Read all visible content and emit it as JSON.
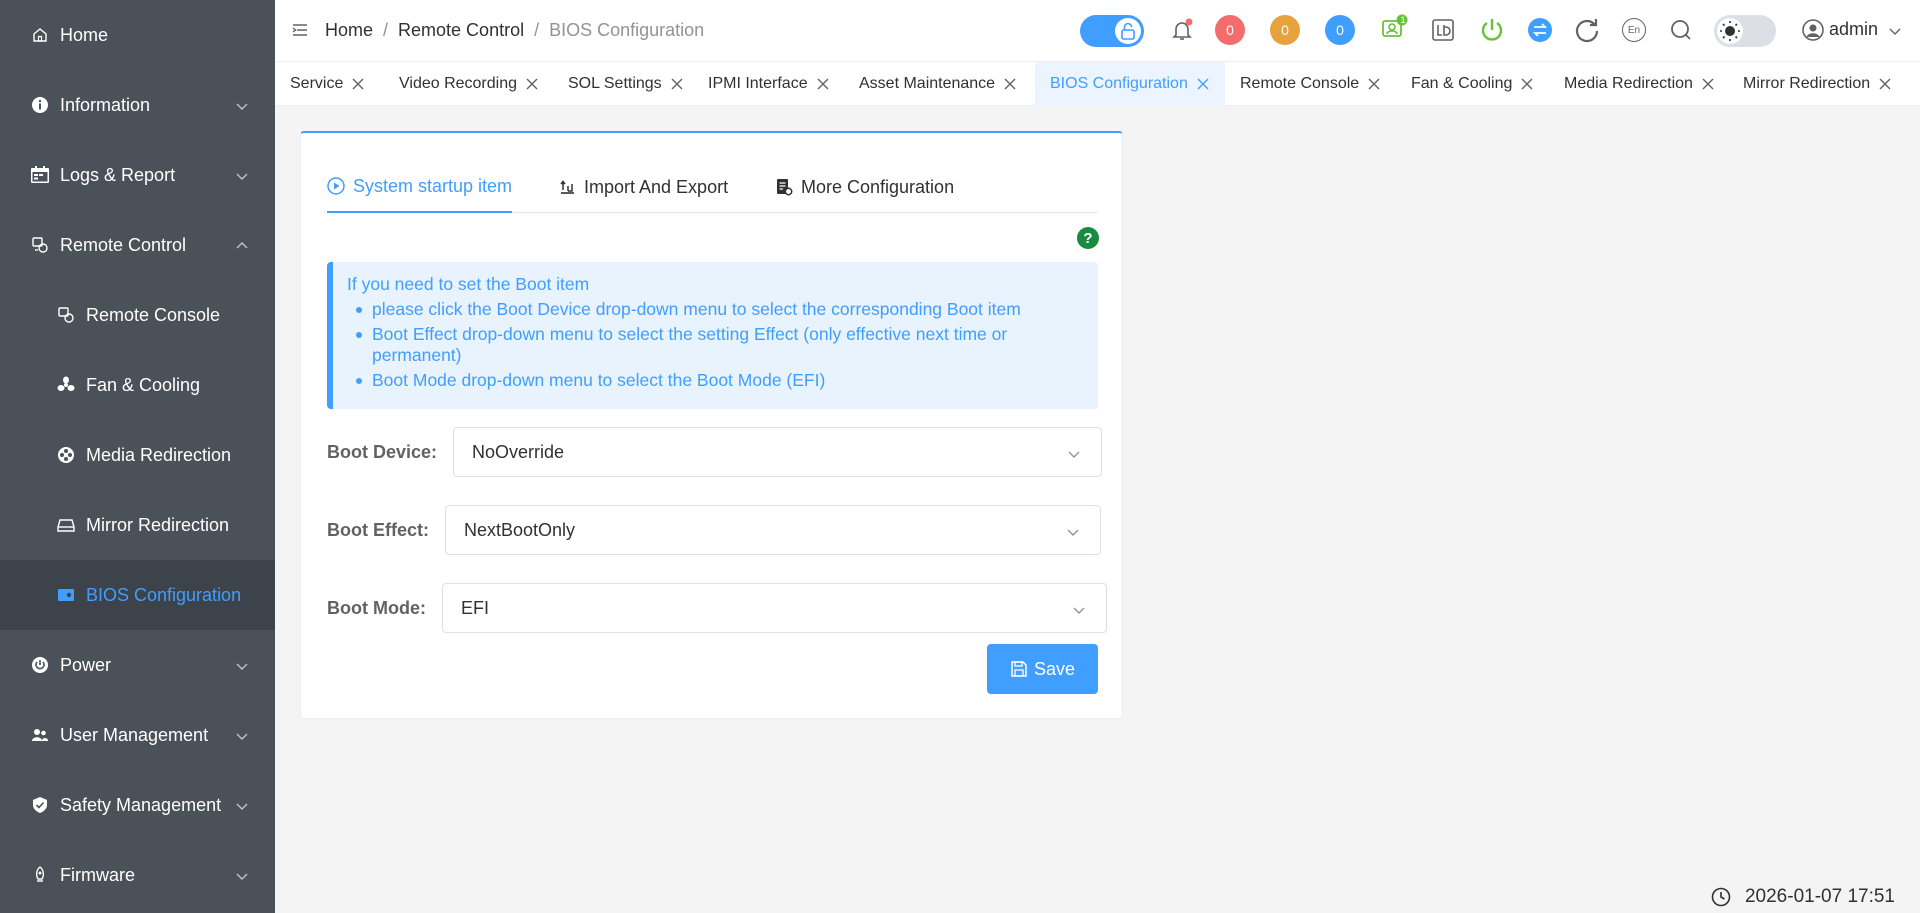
{
  "sidebar": {
    "items": [
      {
        "label": "Home"
      },
      {
        "label": "Information"
      },
      {
        "label": "Logs & Report"
      },
      {
        "label": "Remote Control"
      },
      {
        "label": "Remote Console"
      },
      {
        "label": "Fan & Cooling"
      },
      {
        "label": "Media Redirection"
      },
      {
        "label": "Mirror Redirection"
      },
      {
        "label": "BIOS Configuration"
      },
      {
        "label": "Power"
      },
      {
        "label": "User Management"
      },
      {
        "label": "Safety Management"
      },
      {
        "label": "Firmware"
      }
    ]
  },
  "header": {
    "breadcrumb": [
      "Home",
      "Remote Control",
      "BIOS Configuration"
    ],
    "separator": "/",
    "badges": [
      {
        "value": "0",
        "color": "#f56c6c"
      },
      {
        "value": "0",
        "color": "#e6a23c"
      },
      {
        "value": "0",
        "color": "#409eff"
      }
    ],
    "user_badge": "1",
    "language": "En",
    "username": "admin"
  },
  "tabs": [
    {
      "label": "Service"
    },
    {
      "label": "Video Recording"
    },
    {
      "label": "SOL Settings"
    },
    {
      "label": "IPMI Interface"
    },
    {
      "label": "Asset Maintenance"
    },
    {
      "label": "BIOS Configuration"
    },
    {
      "label": "Remote Console"
    },
    {
      "label": "Fan & Cooling"
    },
    {
      "label": "Media Redirection"
    },
    {
      "label": "Mirror Redirection"
    }
  ],
  "card": {
    "tabs": [
      {
        "label": "System startup item"
      },
      {
        "label": "Import And Export"
      },
      {
        "label": "More Configuration"
      }
    ],
    "help": "?",
    "info": {
      "title": "If you need to set the Boot item",
      "items": [
        "please click the Boot Device drop-down menu to select the corresponding Boot item",
        "Boot Effect drop-down menu to select the setting Effect (only effective next time or permanent)",
        "Boot Mode drop-down menu to select the Boot Mode (EFI)"
      ]
    },
    "form": {
      "boot_device_label": "Boot Device:",
      "boot_device_value": "NoOverride",
      "boot_effect_label": "Boot Effect:",
      "boot_effect_value": "NextBootOnly",
      "boot_mode_label": "Boot Mode:",
      "boot_mode_value": "EFI"
    },
    "save_label": "Save"
  },
  "footer": {
    "datetime": "2026-01-07 17:51"
  },
  "colors": {
    "accent": "#409eff",
    "sidebar_bg": "#4a5158",
    "sidebar_active_bg": "#3d434a",
    "power_green": "#67c23a"
  }
}
